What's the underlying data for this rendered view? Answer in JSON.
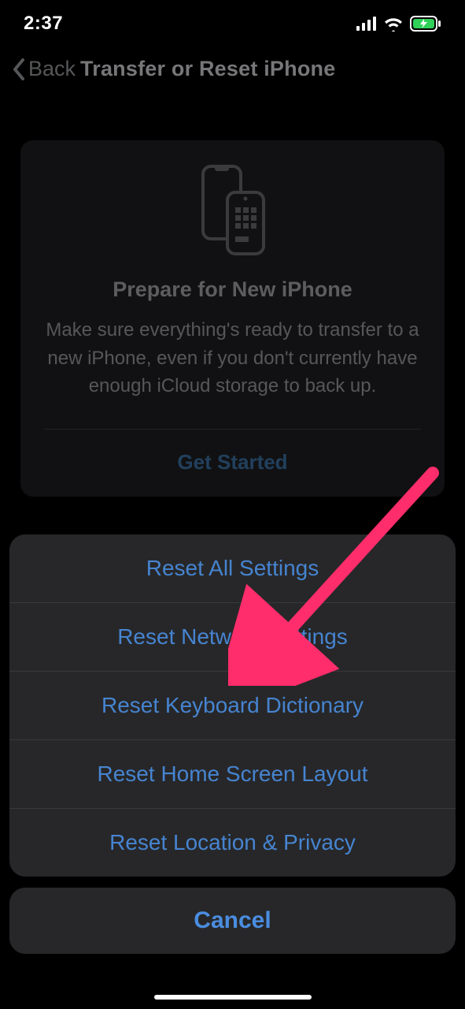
{
  "status": {
    "time": "2:37"
  },
  "nav": {
    "back_label": "Back",
    "title": "Transfer or Reset iPhone"
  },
  "card": {
    "title": "Prepare for New iPhone",
    "description": "Make sure everything's ready to transfer to a new iPhone, even if you don't currently have enough iCloud storage to back up.",
    "cta": "Get Started"
  },
  "sheet": {
    "options": [
      "Reset All Settings",
      "Reset Network Settings",
      "Reset Keyboard Dictionary",
      "Reset Home Screen Layout",
      "Reset Location & Privacy"
    ],
    "cancel": "Cancel"
  },
  "annotation": {
    "target_option_index": 1,
    "arrow_color": "#ff2d55"
  }
}
